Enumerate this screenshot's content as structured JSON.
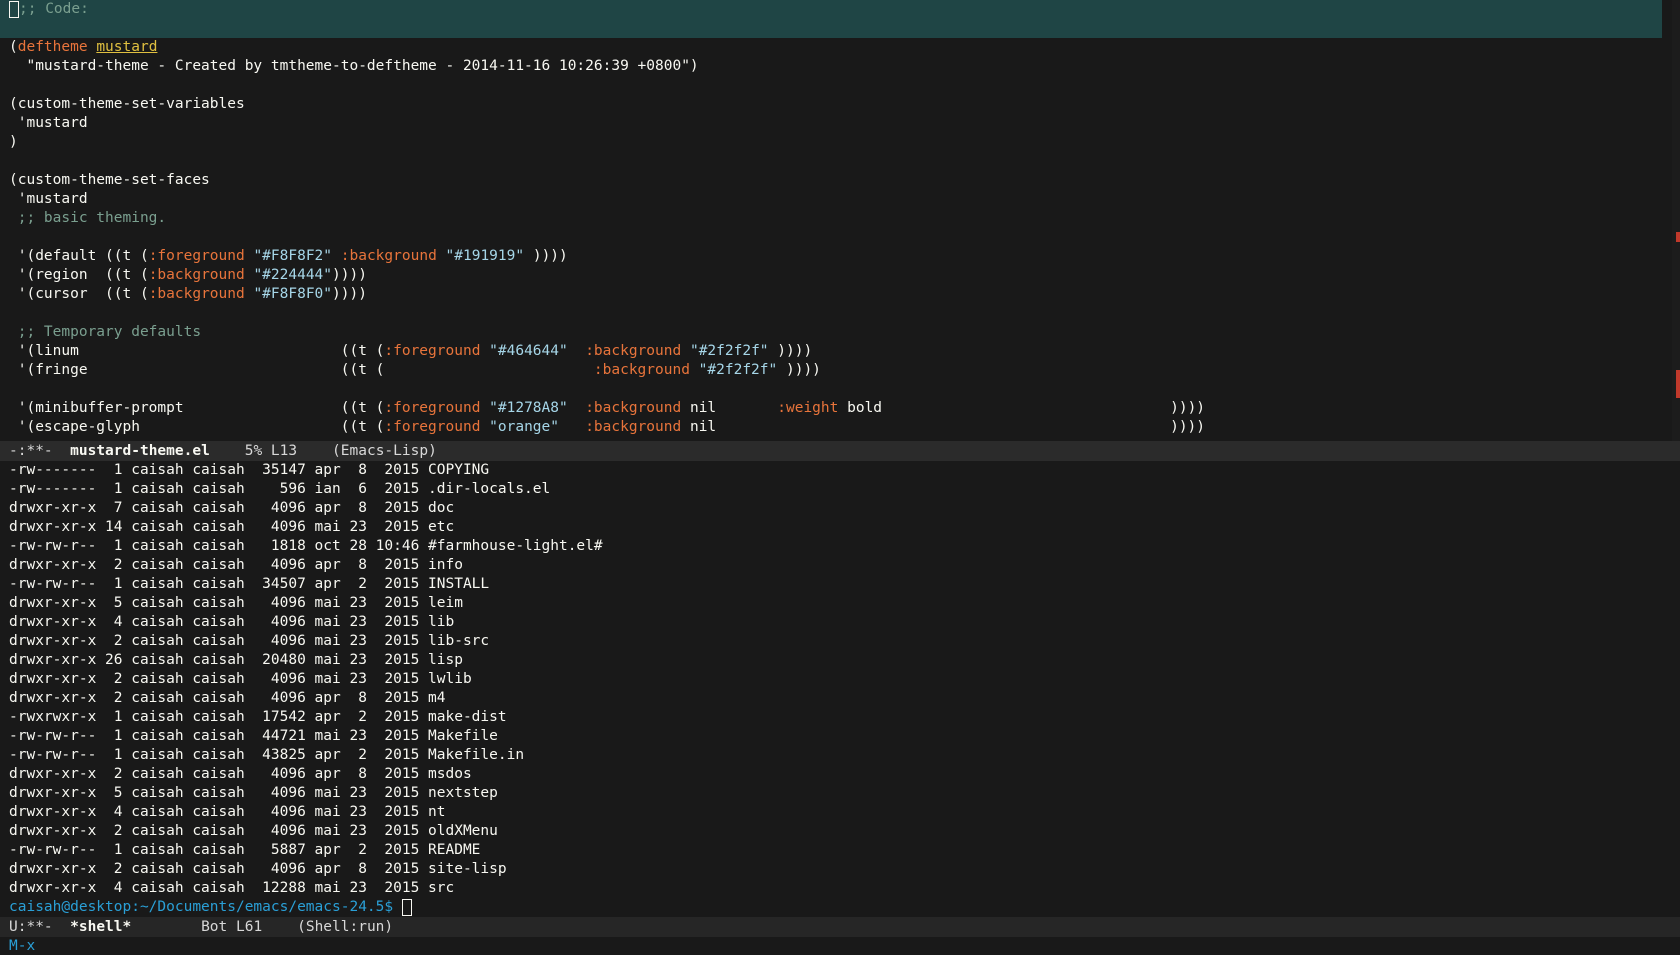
{
  "editor": {
    "code_header": ";; Code:",
    "code_lines": [
      [
        {
          "t": "(",
          "c": ""
        },
        {
          "t": "deftheme",
          "c": "kw"
        },
        {
          "t": " ",
          "c": ""
        },
        {
          "t": "mustard",
          "c": "under"
        }
      ],
      [
        {
          "t": "  \"mustard-theme - Created by tmtheme-to-deftheme - 2014-11-16 10:26:39 +0800\")",
          "c": ""
        }
      ],
      [
        {
          "t": "",
          "c": ""
        }
      ],
      [
        {
          "t": "(custom-theme-set-variables",
          "c": ""
        }
      ],
      [
        {
          "t": " 'mustard",
          "c": ""
        }
      ],
      [
        {
          "t": ")",
          "c": ""
        }
      ],
      [
        {
          "t": "",
          "c": ""
        }
      ],
      [
        {
          "t": "(custom-theme-set-faces",
          "c": ""
        }
      ],
      [
        {
          "t": " 'mustard",
          "c": ""
        }
      ],
      [
        {
          "t": " ;; basic theming.",
          "c": "comment"
        }
      ],
      [
        {
          "t": "",
          "c": ""
        }
      ],
      [
        {
          "t": " '(default ((t (",
          "c": ""
        },
        {
          "t": ":foreground",
          "c": "kw"
        },
        {
          "t": " ",
          "c": ""
        },
        {
          "t": "\"#F8F8F2\"",
          "c": "str"
        },
        {
          "t": " ",
          "c": ""
        },
        {
          "t": ":background",
          "c": "kw"
        },
        {
          "t": " ",
          "c": ""
        },
        {
          "t": "\"#191919\"",
          "c": "str"
        },
        {
          "t": " ))))",
          "c": ""
        }
      ],
      [
        {
          "t": " '(region  ((t (",
          "c": ""
        },
        {
          "t": ":background",
          "c": "kw"
        },
        {
          "t": " ",
          "c": ""
        },
        {
          "t": "\"#224444\"",
          "c": "str"
        },
        {
          "t": "))))",
          "c": ""
        }
      ],
      [
        {
          "t": " '(cursor  ((t (",
          "c": ""
        },
        {
          "t": ":background",
          "c": "kw"
        },
        {
          "t": " ",
          "c": ""
        },
        {
          "t": "\"#F8F8F0\"",
          "c": "str"
        },
        {
          "t": "))))",
          "c": ""
        }
      ],
      [
        {
          "t": "",
          "c": ""
        }
      ],
      [
        {
          "t": " ;; Temporary defaults",
          "c": "comment"
        }
      ],
      [
        {
          "t": " '(linum                              ((t (",
          "c": ""
        },
        {
          "t": ":foreground",
          "c": "kw"
        },
        {
          "t": " ",
          "c": ""
        },
        {
          "t": "\"#464644\"",
          "c": "str"
        },
        {
          "t": "  ",
          "c": ""
        },
        {
          "t": ":background",
          "c": "kw"
        },
        {
          "t": " ",
          "c": ""
        },
        {
          "t": "\"#2f2f2f\"",
          "c": "str"
        },
        {
          "t": " ))))",
          "c": ""
        }
      ],
      [
        {
          "t": " '(fringe                             ((t (                        ",
          "c": ""
        },
        {
          "t": ":background",
          "c": "kw"
        },
        {
          "t": " ",
          "c": ""
        },
        {
          "t": "\"#2f2f2f\"",
          "c": "str"
        },
        {
          "t": " ))))",
          "c": ""
        }
      ],
      [
        {
          "t": "",
          "c": ""
        }
      ],
      [
        {
          "t": " '(minibuffer-prompt                  ((t (",
          "c": ""
        },
        {
          "t": ":foreground",
          "c": "kw"
        },
        {
          "t": " ",
          "c": ""
        },
        {
          "t": "\"#1278A8\"",
          "c": "str"
        },
        {
          "t": "  ",
          "c": ""
        },
        {
          "t": ":background",
          "c": "kw"
        },
        {
          "t": " nil       ",
          "c": ""
        },
        {
          "t": ":weight",
          "c": "kw"
        },
        {
          "t": " bold                                 ))))",
          "c": ""
        }
      ],
      [
        {
          "t": " '(escape-glyph                       ((t (",
          "c": ""
        },
        {
          "t": ":foreground",
          "c": "kw"
        },
        {
          "t": " ",
          "c": ""
        },
        {
          "t": "\"orange\"",
          "c": "str"
        },
        {
          "t": "   ",
          "c": ""
        },
        {
          "t": ":background",
          "c": "kw"
        },
        {
          "t": " nil                                                    ))))",
          "c": ""
        }
      ]
    ]
  },
  "modeline_top": {
    "status": "-:**-",
    "buffer": "mustard-theme.el",
    "position": "5% L13",
    "mode": "(Emacs-Lisp)"
  },
  "shell": {
    "files": [
      "-rw-------  1 caisah caisah  35147 apr  8  2015 COPYING",
      "-rw-------  1 caisah caisah    596 ian  6  2015 .dir-locals.el",
      "drwxr-xr-x  7 caisah caisah   4096 apr  8  2015 doc",
      "drwxr-xr-x 14 caisah caisah   4096 mai 23  2015 etc",
      "-rw-rw-r--  1 caisah caisah   1818 oct 28 10:46 #farmhouse-light.el#",
      "drwxr-xr-x  2 caisah caisah   4096 apr  8  2015 info",
      "-rw-rw-r--  1 caisah caisah  34507 apr  2  2015 INSTALL",
      "drwxr-xr-x  5 caisah caisah   4096 mai 23  2015 leim",
      "drwxr-xr-x  4 caisah caisah   4096 mai 23  2015 lib",
      "drwxr-xr-x  2 caisah caisah   4096 mai 23  2015 lib-src",
      "drwxr-xr-x 26 caisah caisah  20480 mai 23  2015 lisp",
      "drwxr-xr-x  2 caisah caisah   4096 mai 23  2015 lwlib",
      "drwxr-xr-x  2 caisah caisah   4096 apr  8  2015 m4",
      "-rwxrwxr-x  1 caisah caisah  17542 apr  2  2015 make-dist",
      "-rw-rw-r--  1 caisah caisah  44721 mai 23  2015 Makefile",
      "-rw-rw-r--  1 caisah caisah  43825 apr  2  2015 Makefile.in",
      "drwxr-xr-x  2 caisah caisah   4096 apr  8  2015 msdos",
      "drwxr-xr-x  5 caisah caisah   4096 mai 23  2015 nextstep",
      "drwxr-xr-x  4 caisah caisah   4096 mai 23  2015 nt",
      "drwxr-xr-x  2 caisah caisah   4096 mai 23  2015 oldXMenu",
      "-rw-rw-r--  1 caisah caisah   5887 apr  2  2015 README",
      "drwxr-xr-x  2 caisah caisah   4096 apr  8  2015 site-lisp",
      "drwxr-xr-x  4 caisah caisah  12288 mai 23  2015 src"
    ],
    "prompt": "caisah@desktop:~/Documents/emacs/emacs-24.5$"
  },
  "modeline_bottom": {
    "status": "U:**-",
    "buffer": "*shell*",
    "position": "Bot L61",
    "mode": "(Shell:run)"
  },
  "minibuffer": {
    "text": "M-x"
  }
}
